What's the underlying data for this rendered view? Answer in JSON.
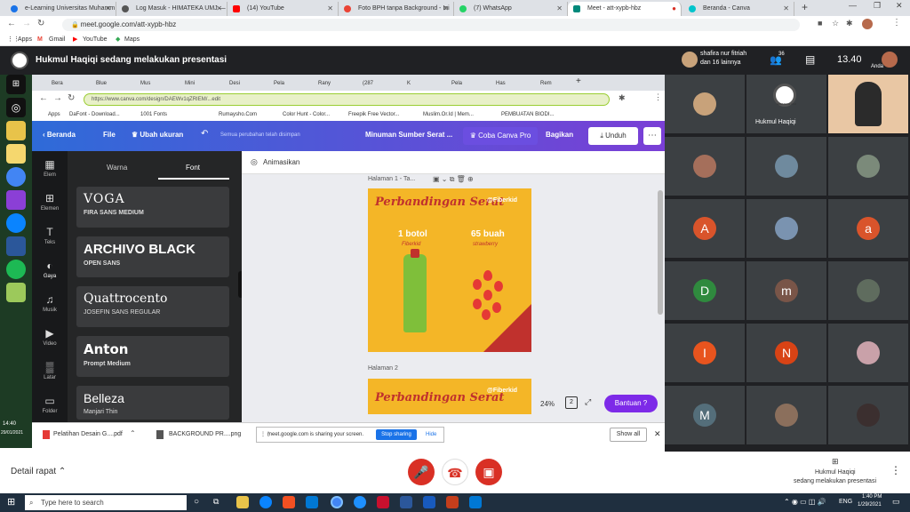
{
  "outer_browser": {
    "tabs": [
      {
        "label": "e-Learning Universitas Muhamm",
        "color": "#1a73e8"
      },
      {
        "label": "Log Masuk - HIMATEKA UMJ —",
        "color": "#555555"
      },
      {
        "label": "(14) YouTube",
        "color": "#ff0000"
      },
      {
        "label": "Foto BPH tanpa Background - Ini",
        "color": "#ea4335"
      },
      {
        "label": "(7) WhatsApp",
        "color": "#25d366"
      },
      {
        "label": "Meet - att-xypb-hbz",
        "color": "#00897b"
      },
      {
        "label": "Beranda - Canva",
        "color": "#00c4cc"
      }
    ],
    "url": "meet.google.com/att-xypb-hbz",
    "bookmarks": [
      "Apps",
      "Gmail",
      "YouTube",
      "Maps"
    ]
  },
  "meet": {
    "presenting_text": "Hukmul Haqiqi sedang melakukan presentasi",
    "host_name": "shafira nur fitriah",
    "host_others": "dan 16 lainnya",
    "participant_count": "36",
    "clock": "13.40",
    "you_label": "Anda",
    "meeting_details": "Detail rapat",
    "presenter_footer_name": "Hukmul Haqiqi",
    "presenter_footer_status": "sedang melakukan presentasi",
    "presenter_tile_name": "Hukmul Haqiqi",
    "presenter_logo_text": "HIMATEKA UMJ"
  },
  "participants": [
    {
      "initial": "",
      "color": "#c8a27a",
      "photo": true
    },
    {
      "initial": "",
      "color": "#2d2d2d",
      "photo": true,
      "presenter": true
    },
    {
      "initial": "",
      "color": "#e9c7a4",
      "photo": true,
      "wide": true
    },
    {
      "initial": "",
      "color": "#a56f5b",
      "photo": true
    },
    {
      "initial": "",
      "color": "#6f8a9e",
      "photo": true
    },
    {
      "initial": "",
      "color": "#7b8a7a",
      "photo": true
    },
    {
      "initial": "A",
      "color": "#d9542b"
    },
    {
      "initial": "",
      "color": "#7a93b0",
      "photo": true
    },
    {
      "initial": "a",
      "color": "#d9542b"
    },
    {
      "initial": "D",
      "color": "#2f8a3e"
    },
    {
      "initial": "m",
      "color": "#795548"
    },
    {
      "initial": "",
      "color": "#5f6c5e",
      "photo": true
    },
    {
      "initial": "I",
      "color": "#e8541e"
    },
    {
      "initial": "N",
      "color": "#d84315"
    },
    {
      "initial": "",
      "color": "#c9a1a9",
      "photo": true
    },
    {
      "initial": "M",
      "color": "#546e7a"
    },
    {
      "initial": "",
      "color": "#8b6f5c",
      "photo": true
    },
    {
      "initial": "",
      "color": "#3b2f2f",
      "photo": true
    }
  ],
  "shared_screen": {
    "inner_tabs": [
      "Bera",
      "Blue",
      "Mus",
      "Mini",
      "Desi",
      "Pela",
      "Rany",
      "(287",
      "K",
      "Pela",
      "Has",
      "Rem"
    ],
    "inner_url": "https://www.canva.com/design/DAEWv1qZRIEM/...edit",
    "inner_bookmarks": [
      "Apps",
      "DaFont - Download...",
      "1001 Fonts",
      "Rumaysho.Com",
      "Color Hunt - Color...",
      "Freepik Free Vector...",
      "Muslim.Or.Id | Mem...",
      "PEMBUATAN BIODI..."
    ],
    "canva_top": {
      "home": "Beranda",
      "file": "File",
      "resize": "Ubah ukuran",
      "saved": "Semua perubahan telah disimpan",
      "doc_title": "Minuman Sumber Serat ...",
      "try_pro": "Coba Canva Pro",
      "share": "Bagikan",
      "download": "Unduh"
    },
    "canva_side": [
      "Elem",
      "Elemen",
      "Teks",
      "Gaya",
      "Musik",
      "Video",
      "Latar",
      "Folder"
    ],
    "panel_tabs": [
      "Warna",
      "Font"
    ],
    "fonts": [
      {
        "title": "VOGA",
        "subtitle": "FIRA SANS MEDIUM"
      },
      {
        "title": "ARCHIVO BLACK",
        "subtitle": "OPEN SANS"
      },
      {
        "title": "Quattrocento",
        "subtitle": "JOSEFIN SANS REGULAR"
      },
      {
        "title": "Anton",
        "subtitle": "Prompt Medium"
      },
      {
        "title": "Belleza",
        "subtitle": "Manjari Thin"
      }
    ],
    "animate": "Animasikan",
    "page1_label": "Halaman 1 - Ta...",
    "page2_label": "Halaman 2",
    "slide_title": "Perbandingan Serat",
    "slide_handle": "@Fiberkid",
    "col1_title": "1 botol",
    "col1_sub": "Fiberkid",
    "col2_title": "65 buah",
    "col2_sub": "strawberry",
    "zoom": "24%",
    "page_count": "2",
    "help": "Bantuan",
    "downloads": [
      "Pelatihan Desain G....pdf",
      "BACKGROUND PR....png"
    ],
    "show_all": "Show all",
    "share_notice": "meet.google.com is sharing your screen.",
    "stop_sharing": "Stop sharing",
    "hide": "Hide",
    "task_time": "14:40",
    "task_date": "29/01/2021"
  },
  "windows": {
    "search_placeholder": "Type here to search",
    "time": "1:40 PM",
    "date": "1/29/2021",
    "lang": "ENG"
  }
}
